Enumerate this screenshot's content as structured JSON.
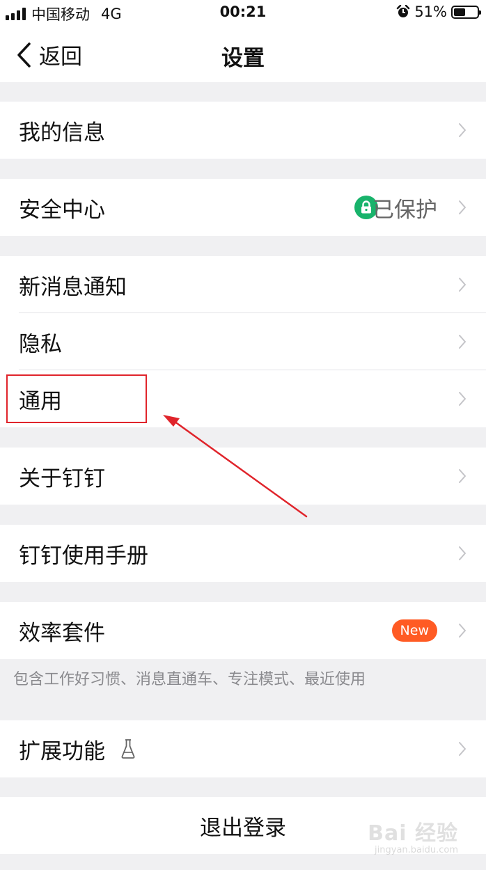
{
  "status_bar": {
    "carrier": "中国移动",
    "network": "4G",
    "time": "00:21",
    "battery": "51%",
    "battery_level": 0.51
  },
  "nav": {
    "back_label": "返回",
    "title": "设置"
  },
  "menu": {
    "my_info": "我的信息",
    "security_center": "安全中心",
    "security_status": "已保护",
    "new_message_notify": "新消息通知",
    "privacy": "隐私",
    "general": "通用",
    "about": "关于钉钉",
    "manual": "钉钉使用手册",
    "efficiency_suite": "效率套件",
    "new_badge": "New",
    "efficiency_hint": "包含工作好习惯、消息直通车、专注模式、最近使用",
    "extensions": "扩展功能",
    "logout": "退出登录"
  },
  "watermark": {
    "main": "Bai 经验",
    "sub": "jingyan.baidu.com"
  },
  "colors": {
    "lock_green": "#18b36b",
    "new_orange": "#ff5b24",
    "annotation_red": "#e0242b"
  }
}
